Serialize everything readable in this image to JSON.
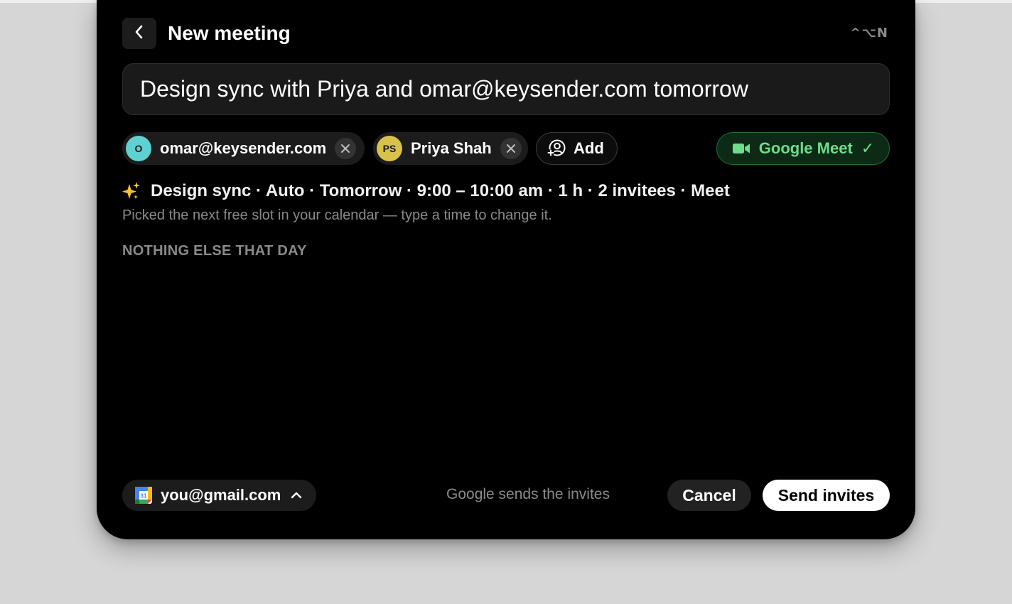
{
  "header": {
    "title": "New meeting",
    "shortcut": "^⌥N"
  },
  "prompt": {
    "value": "Design sync with Priya and omar@keysender.com tomorrow"
  },
  "invitees": [
    {
      "initials": "O",
      "label": "omar@keysender.com",
      "avatar_color": "#5fd1d1"
    },
    {
      "initials": "PS",
      "label": "Priya Shah",
      "avatar_color": "#d9c24a"
    }
  ],
  "add_label": "Add",
  "conference": {
    "label": "Google Meet",
    "check": "✓",
    "color": "#6fdc8c"
  },
  "summary": {
    "text": "Design sync · Auto · Tomorrow · 9:00 – 10:00 am · 1 h · 2 invitees · Meet",
    "hint": "Picked the next free slot in your calendar — type a time to change it."
  },
  "day_section": {
    "label": "NOTHING ELSE THAT DAY"
  },
  "footer": {
    "account": "you@gmail.com",
    "calendar_day": "31",
    "note": "Google sends the invites",
    "cancel_label": "Cancel",
    "send_label": "Send invites"
  }
}
